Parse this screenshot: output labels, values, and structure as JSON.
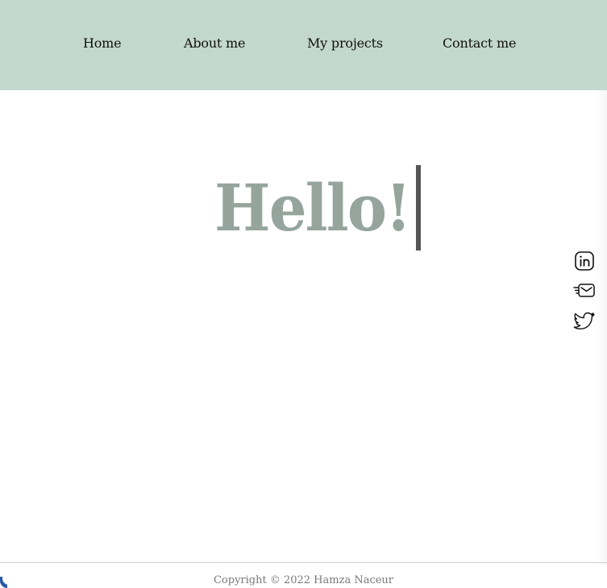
{
  "nav": {
    "items": [
      {
        "label": "Home"
      },
      {
        "label": "About me"
      },
      {
        "label": "My projects"
      },
      {
        "label": "Contact me"
      }
    ]
  },
  "hero": {
    "text": "Hello!"
  },
  "social": {
    "icons": [
      "linkedin-icon",
      "email-icon",
      "twitter-icon"
    ]
  },
  "footer": {
    "copyright": "Copyright © 2022 Hamza Naceur"
  },
  "colors": {
    "navbar_bg": "#c3d8ce",
    "hero_text": "#95a59e",
    "cursor": "#555555",
    "footer_text": "#7a7a7a"
  }
}
